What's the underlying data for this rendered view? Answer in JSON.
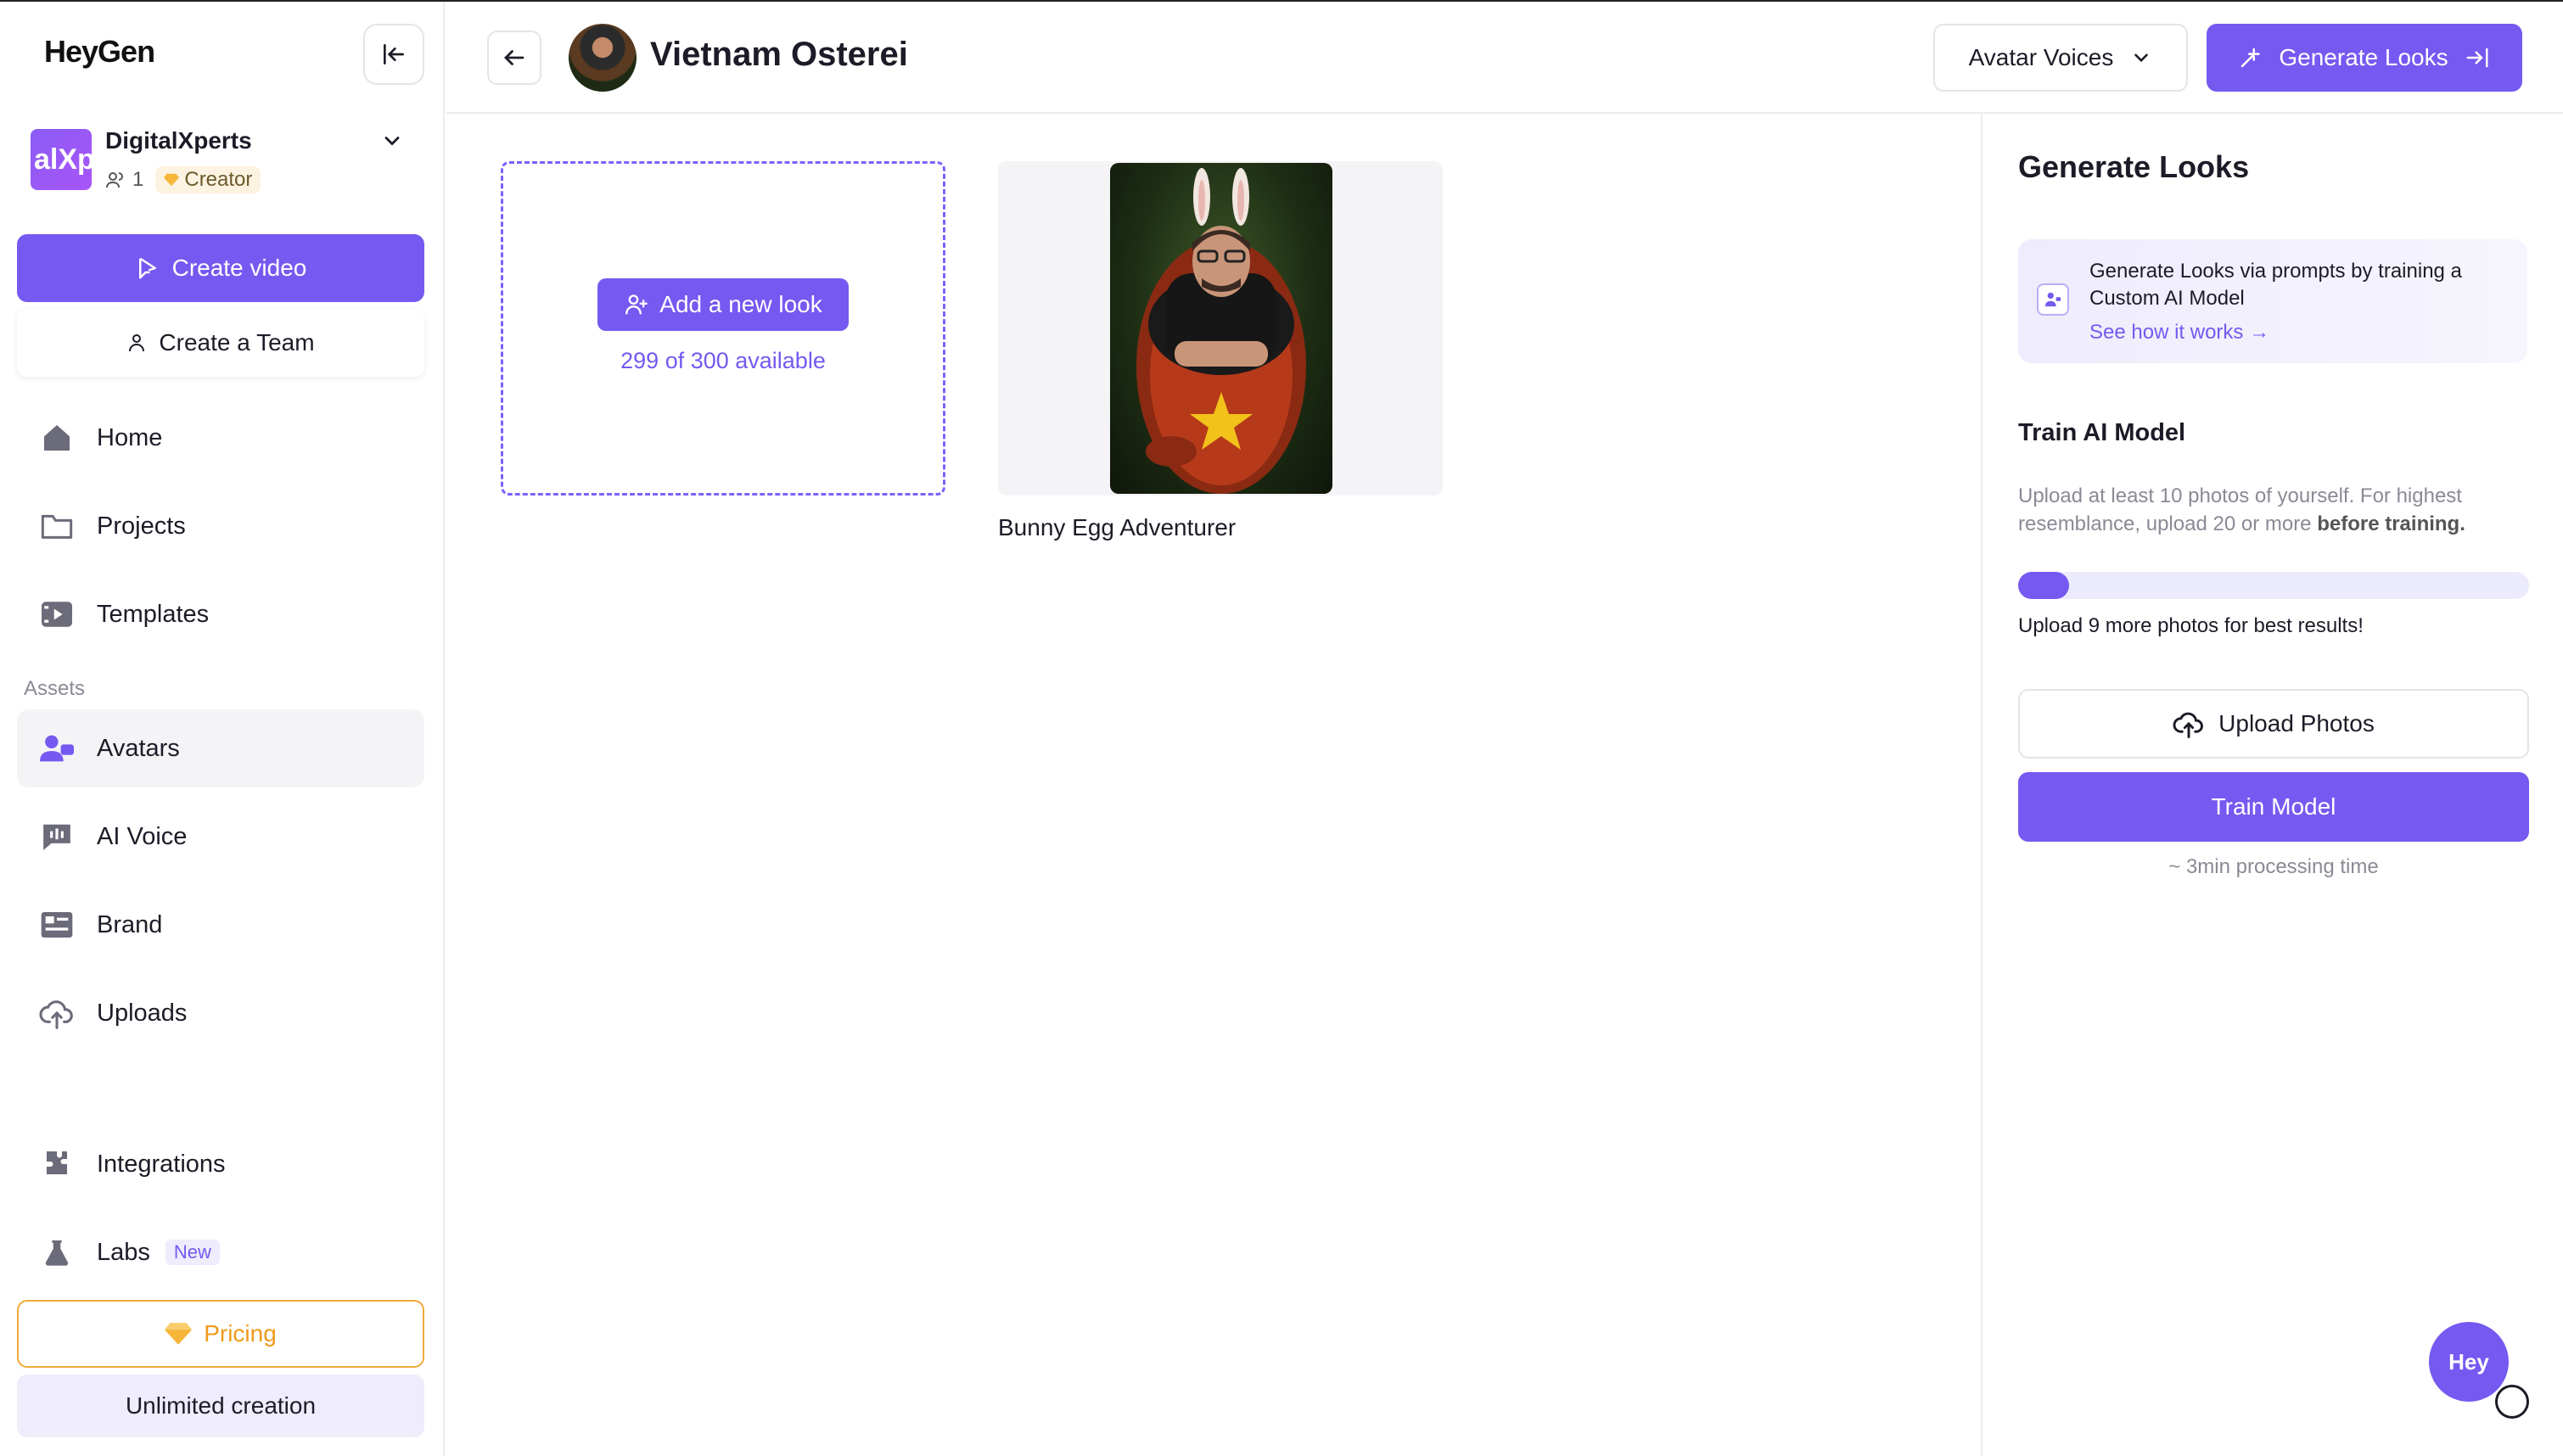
{
  "brand": {
    "logo_text": "HeyGen"
  },
  "workspace": {
    "avatar_text": "alXp",
    "name": "DigitalXperts",
    "member_count": "1",
    "plan_badge": "Creator"
  },
  "sidebar": {
    "create_video_label": "Create video",
    "create_team_label": "Create a Team",
    "nav_items": [
      {
        "label": "Home",
        "icon": "home-icon"
      },
      {
        "label": "Projects",
        "icon": "folder-icon"
      },
      {
        "label": "Templates",
        "icon": "templates-icon"
      }
    ],
    "assets_label": "Assets",
    "asset_items": [
      {
        "label": "Avatars",
        "icon": "avatar-icon",
        "active": true
      },
      {
        "label": "AI Voice",
        "icon": "voice-icon"
      },
      {
        "label": "Brand",
        "icon": "brand-icon"
      },
      {
        "label": "Uploads",
        "icon": "upload-cloud-icon"
      }
    ],
    "bottom_items": [
      {
        "label": "Integrations",
        "icon": "puzzle-icon"
      },
      {
        "label": "Labs",
        "icon": "flask-icon",
        "badge": "New"
      }
    ],
    "pricing_label": "Pricing",
    "unlimited_label": "Unlimited creation"
  },
  "header": {
    "title": "Vietnam Osterei",
    "voices_select_label": "Avatar Voices",
    "generate_looks_label": "Generate Looks"
  },
  "main": {
    "add_look_label": "Add a new look",
    "availability": "299 of 300 available",
    "looks": [
      {
        "title": "Bunny Egg Adventurer"
      }
    ]
  },
  "right_panel": {
    "title": "Generate Looks",
    "info_text": "Generate Looks via prompts by training a Custom AI Model",
    "info_link": "See how it works →",
    "train_title": "Train AI Model",
    "train_desc_prefix": "Upload at least 10 photos of yourself. For highest resemblance, upload 20 or more ",
    "train_desc_bold": "before training.",
    "progress_fraction": 0.05,
    "progress_note": "Upload 9 more photos for best results!",
    "upload_label": "Upload Photos",
    "train_label": "Train Model",
    "processing_time": "~ 3min processing time"
  },
  "chat": {
    "bubble_text": "Hey"
  },
  "colors": {
    "accent": "#7559f0",
    "pricing": "#f09a1b",
    "border": "#e4e4ea"
  }
}
